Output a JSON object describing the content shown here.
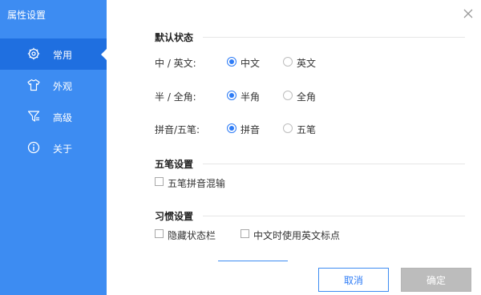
{
  "window": {
    "title": "属性设置"
  },
  "sidebar": {
    "items": [
      {
        "label": "常用",
        "icon": "gear-icon",
        "active": true
      },
      {
        "label": "外观",
        "icon": "shirt-icon",
        "active": false
      },
      {
        "label": "高级",
        "icon": "filter-icon",
        "active": false
      },
      {
        "label": "关于",
        "icon": "info-icon",
        "active": false
      }
    ]
  },
  "sections": {
    "default_state": {
      "title": "默认状态",
      "rows": [
        {
          "label": "中 / 英文:",
          "options": [
            "中文",
            "英文"
          ],
          "selected": "中文"
        },
        {
          "label": "半 / 全角:",
          "options": [
            "半角",
            "全角"
          ],
          "selected": "半角"
        },
        {
          "label": "拼音/五笔:",
          "options": [
            "拼音",
            "五笔"
          ],
          "selected": "拼音"
        }
      ]
    },
    "wubi": {
      "title": "五笔设置",
      "mixed_input": {
        "label": "五笔拼音混输",
        "checked": false
      }
    },
    "habits": {
      "title": "习惯设置",
      "hide_statusbar": {
        "label": "隐藏状态栏",
        "checked": false
      },
      "english_punct": {
        "label": "中文时使用英文标点",
        "checked": false
      }
    }
  },
  "footer": {
    "cancel_label": "取消",
    "ok_label": "确定"
  },
  "colors": {
    "sidebar": "#3d8cf2",
    "sidebar_active": "#1f6fe0",
    "accent": "#2e7cf6",
    "disabled": "#bcbcbc"
  }
}
